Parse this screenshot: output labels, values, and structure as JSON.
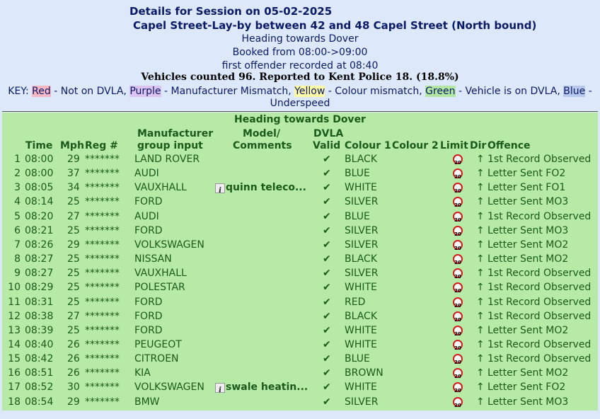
{
  "header": {
    "title": "Details for Session on 05-02-2025",
    "location": "Capel Street-Lay-by between 42 and 48 Capel Street (North bound)",
    "heading": "Heading towards Dover",
    "booked": "Booked from 08:00->09:00",
    "first_offender": "first offender recorded at 08:40",
    "vehicles_counted": "Vehicles counted 96.  Reported to Kent Police 18. (18.8%)"
  },
  "key": {
    "prefix": "KEY: ",
    "red": "Red",
    "red_desc": " - Not on DVLA, ",
    "purple": "Purple",
    "purple_desc": " - Manufacturer Mismatch, ",
    "yellow": "Yellow",
    "yellow_desc": " - Colour mismatch, ",
    "green": "Green",
    "green_desc": " - Vehicle is on DVLA, ",
    "blue": "Blue",
    "blue_desc": " - Underspeed",
    "colors": {
      "red": "#f7b7c4",
      "purple": "#dcc3f2",
      "yellow": "#fffaa5",
      "green": "#b2e6a2",
      "blue": "#b8c8ee"
    }
  },
  "table": {
    "section_title": "Heading towards Dover",
    "headers": {
      "time": "Time",
      "mph": "Mph",
      "reg": "Reg #",
      "manufacturer_1": "Manufacturer",
      "manufacturer_2": "group input",
      "model_1": "Model/",
      "model_2": "Comments",
      "dvla_1": "DVLA",
      "dvla_2": "Valid",
      "colour1": "Colour  1",
      "colour2": "Colour  2",
      "limit": "Limit",
      "dir": "Dir",
      "offence": "Offence"
    },
    "limit_sign": "20",
    "dir_symbol": "↑",
    "check_symbol": "✔",
    "info_symbol": "i",
    "rows": [
      {
        "idx": "1",
        "time": "08:00",
        "mph": "29",
        "reg": "*******",
        "make": "LAND ROVER",
        "comment": "",
        "colour": "BLACK",
        "offence": "1st Record Observed"
      },
      {
        "idx": "2",
        "time": "08:00",
        "mph": "37",
        "reg": "*******",
        "make": "AUDI",
        "comment": "",
        "colour": "BLUE",
        "offence": "Letter Sent FO2"
      },
      {
        "idx": "3",
        "time": "08:05",
        "mph": "34",
        "reg": "*******",
        "make": "VAUXHALL",
        "comment": "quinn teleco...",
        "colour": "WHITE",
        "offence": "Letter Sent FO1"
      },
      {
        "idx": "4",
        "time": "08:14",
        "mph": "25",
        "reg": "*******",
        "make": "FORD",
        "comment": "",
        "colour": "SILVER",
        "offence": "Letter Sent MO3"
      },
      {
        "idx": "5",
        "time": "08:20",
        "mph": "27",
        "reg": "*******",
        "make": "AUDI",
        "comment": "",
        "colour": "BLUE",
        "offence": "1st Record Observed"
      },
      {
        "idx": "6",
        "time": "08:21",
        "mph": "25",
        "reg": "*******",
        "make": "FORD",
        "comment": "",
        "colour": "SILVER",
        "offence": "Letter Sent MO3"
      },
      {
        "idx": "7",
        "time": "08:26",
        "mph": "29",
        "reg": "*******",
        "make": "VOLKSWAGEN",
        "comment": "",
        "colour": "SILVER",
        "offence": "Letter Sent MO2"
      },
      {
        "idx": "8",
        "time": "08:27",
        "mph": "25",
        "reg": "*******",
        "make": "NISSAN",
        "comment": "",
        "colour": "BLACK",
        "offence": "Letter Sent MO2"
      },
      {
        "idx": "9",
        "time": "08:27",
        "mph": "25",
        "reg": "*******",
        "make": "VAUXHALL",
        "comment": "",
        "colour": "SILVER",
        "offence": "1st Record Observed"
      },
      {
        "idx": "10",
        "time": "08:29",
        "mph": "25",
        "reg": "*******",
        "make": "POLESTAR",
        "comment": "",
        "colour": "WHITE",
        "offence": "1st Record Observed"
      },
      {
        "idx": "11",
        "time": "08:31",
        "mph": "25",
        "reg": "*******",
        "make": "FORD",
        "comment": "",
        "colour": "RED",
        "offence": "1st Record Observed"
      },
      {
        "idx": "12",
        "time": "08:38",
        "mph": "27",
        "reg": "*******",
        "make": "FORD",
        "comment": "",
        "colour": "BLACK",
        "offence": "1st Record Observed"
      },
      {
        "idx": "13",
        "time": "08:39",
        "mph": "25",
        "reg": "*******",
        "make": "FORD",
        "comment": "",
        "colour": "WHITE",
        "offence": "Letter Sent MO2"
      },
      {
        "idx": "14",
        "time": "08:40",
        "mph": "26",
        "reg": "*******",
        "make": "PEUGEOT",
        "comment": "",
        "colour": "WHITE",
        "offence": "1st Record Observed"
      },
      {
        "idx": "15",
        "time": "08:42",
        "mph": "26",
        "reg": "*******",
        "make": "CITROEN",
        "comment": "",
        "colour": "BLUE",
        "offence": "1st Record Observed"
      },
      {
        "idx": "16",
        "time": "08:51",
        "mph": "26",
        "reg": "*******",
        "make": "KIA",
        "comment": "",
        "colour": "BROWN",
        "offence": "Letter Sent MO2"
      },
      {
        "idx": "17",
        "time": "08:52",
        "mph": "30",
        "reg": "*******",
        "make": "VOLKSWAGEN",
        "comment": "swale heatin...",
        "colour": "WHITE",
        "offence": "Letter Sent FO2"
      },
      {
        "idx": "18",
        "time": "08:54",
        "mph": "29",
        "reg": "*******",
        "make": "BMW",
        "comment": "",
        "colour": "SILVER",
        "offence": "Letter Sent MO3"
      }
    ]
  }
}
